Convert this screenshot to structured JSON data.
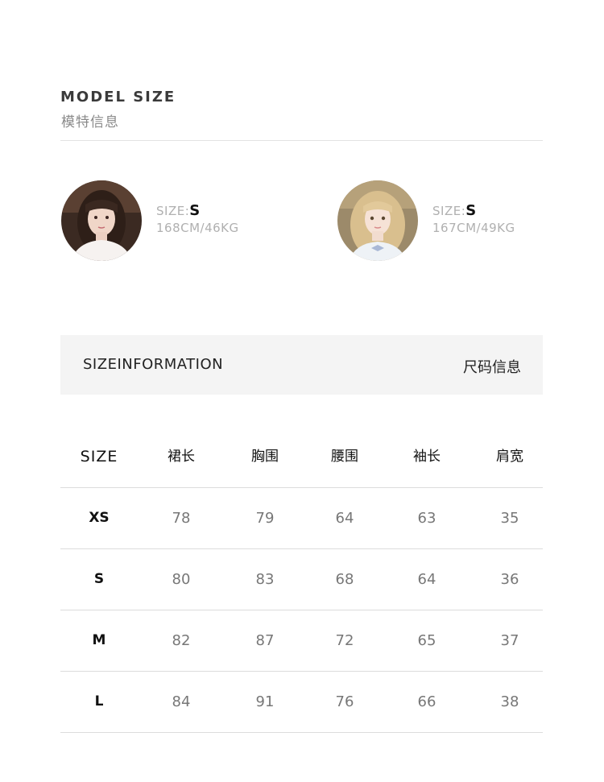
{
  "header": {
    "title_en": "MODEL SIZE",
    "title_cn": "模特信息"
  },
  "models": [
    {
      "size_label": "SIZE:",
      "size_value": "S",
      "measurements": "168CM/46KG"
    },
    {
      "size_label": "SIZE:",
      "size_value": "S",
      "measurements": "167CM/49KG"
    }
  ],
  "size_info": {
    "label_en": "SIZEINFORMATION",
    "label_cn": "尺码信息"
  },
  "table": {
    "headers": [
      "SIZE",
      "裙长",
      "胸围",
      "腰围",
      "袖长",
      "肩宽"
    ],
    "rows": [
      [
        "XS",
        "78",
        "79",
        "64",
        "63",
        "35"
      ],
      [
        "S",
        "80",
        "83",
        "68",
        "64",
        "36"
      ],
      [
        "M",
        "82",
        "87",
        "72",
        "65",
        "37"
      ],
      [
        "L",
        "84",
        "91",
        "76",
        "66",
        "38"
      ]
    ]
  }
}
